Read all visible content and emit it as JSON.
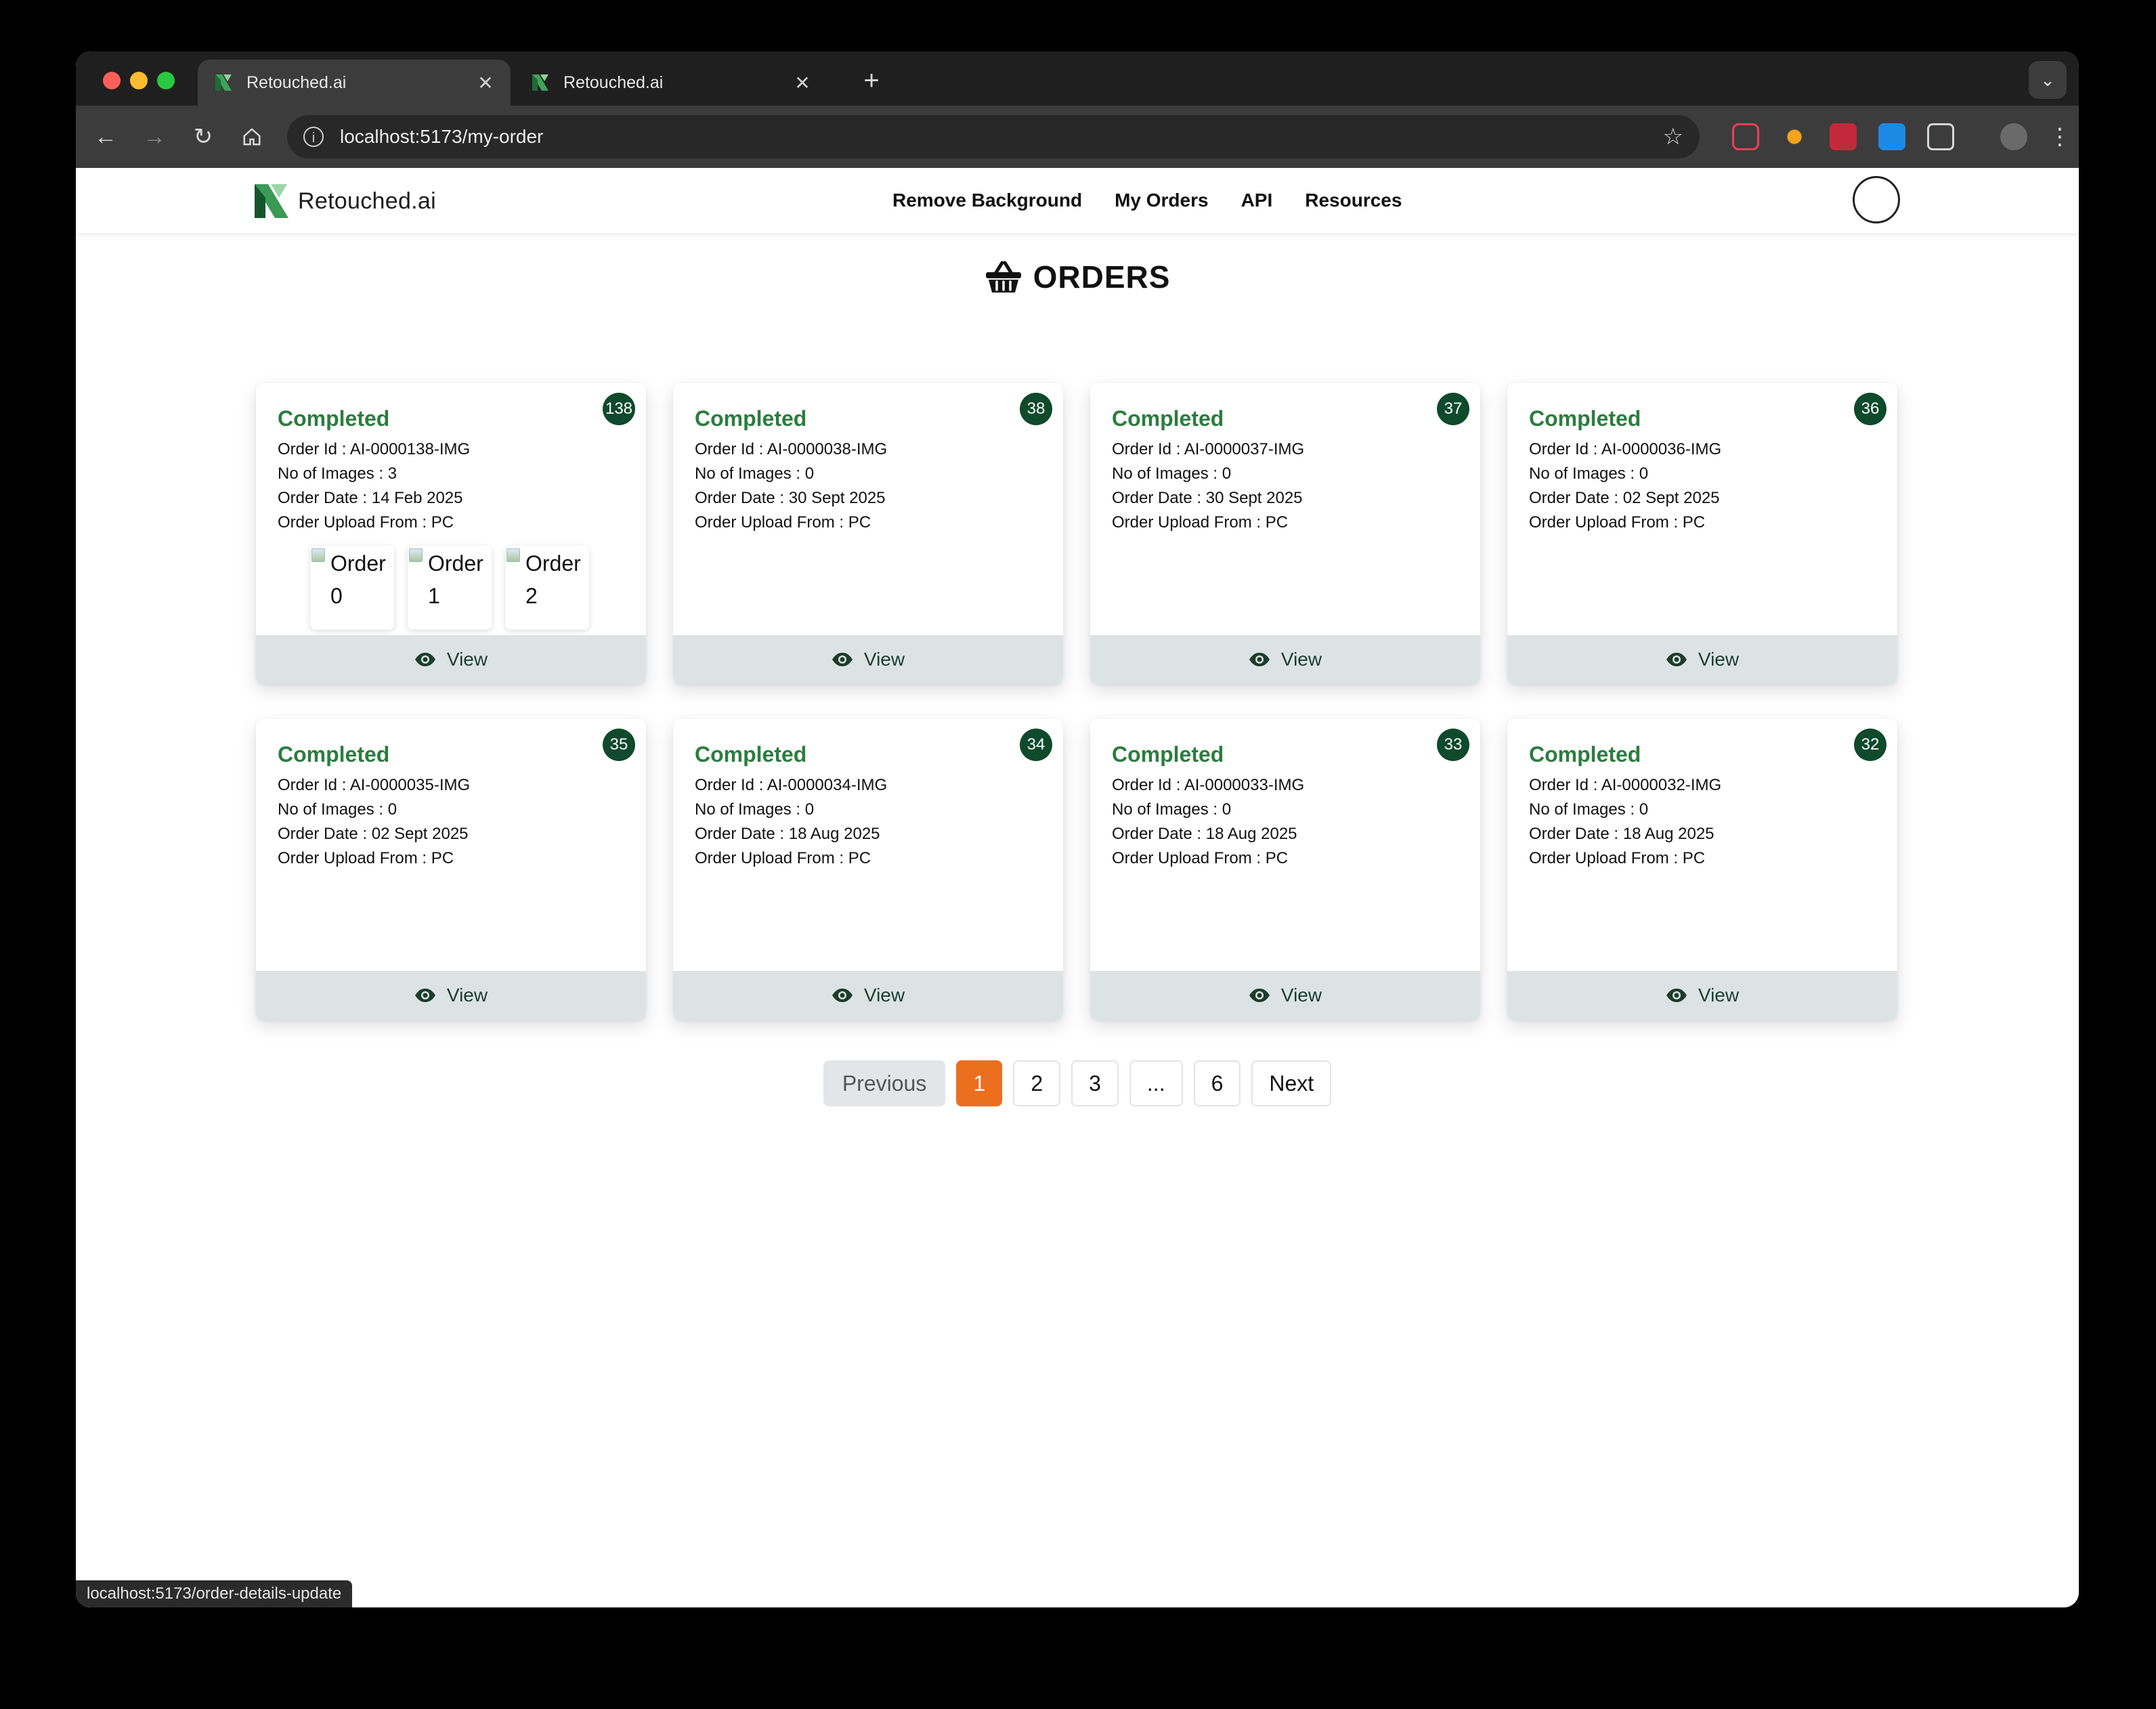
{
  "browser": {
    "tabs": [
      {
        "title": "Retouched.ai",
        "active": true
      },
      {
        "title": "Retouched.ai",
        "active": false
      }
    ],
    "url": "localhost:5173/my-order",
    "status_url": "localhost:5173/order-details-update"
  },
  "app": {
    "brand": "Retouched.ai",
    "brand_color": "#2b7d3e",
    "nav": [
      "Remove Background",
      "My Orders",
      "API",
      "Resources"
    ]
  },
  "page": {
    "title": "ORDERS",
    "labels": {
      "order_id": "Order Id : ",
      "images": "No of Images : ",
      "date": "Order Date : ",
      "upload": "Order Upload From : ",
      "view": "View"
    }
  },
  "orders": [
    {
      "badge": "138",
      "status": "Completed",
      "order_id": "AI-0000138-IMG",
      "images": "3",
      "date": "14 Feb 2025",
      "upload": "PC",
      "thumbs": [
        "Order 0",
        "Order 1",
        "Order 2"
      ]
    },
    {
      "badge": "38",
      "status": "Completed",
      "order_id": "AI-0000038-IMG",
      "images": "0",
      "date": "30 Sept 2025",
      "upload": "PC",
      "thumbs": []
    },
    {
      "badge": "37",
      "status": "Completed",
      "order_id": "AI-0000037-IMG",
      "images": "0",
      "date": "30 Sept 2025",
      "upload": "PC",
      "thumbs": []
    },
    {
      "badge": "36",
      "status": "Completed",
      "order_id": "AI-0000036-IMG",
      "images": "0",
      "date": "02 Sept 2025",
      "upload": "PC",
      "thumbs": []
    },
    {
      "badge": "35",
      "status": "Completed",
      "order_id": "AI-0000035-IMG",
      "images": "0",
      "date": "02 Sept 2025",
      "upload": "PC",
      "thumbs": []
    },
    {
      "badge": "34",
      "status": "Completed",
      "order_id": "AI-0000034-IMG",
      "images": "0",
      "date": "18 Aug 2025",
      "upload": "PC",
      "thumbs": []
    },
    {
      "badge": "33",
      "status": "Completed",
      "order_id": "AI-0000033-IMG",
      "images": "0",
      "date": "18 Aug 2025",
      "upload": "PC",
      "thumbs": []
    },
    {
      "badge": "32",
      "status": "Completed",
      "order_id": "AI-0000032-IMG",
      "images": "0",
      "date": "18 Aug 2025",
      "upload": "PC",
      "thumbs": []
    }
  ],
  "pagination": {
    "previous": "Previous",
    "pages": [
      "1",
      "2",
      "3",
      "...",
      "6"
    ],
    "current": "1",
    "next": "Next"
  },
  "icons": {
    "basket": "basket-icon",
    "eye": "eye-icon"
  }
}
